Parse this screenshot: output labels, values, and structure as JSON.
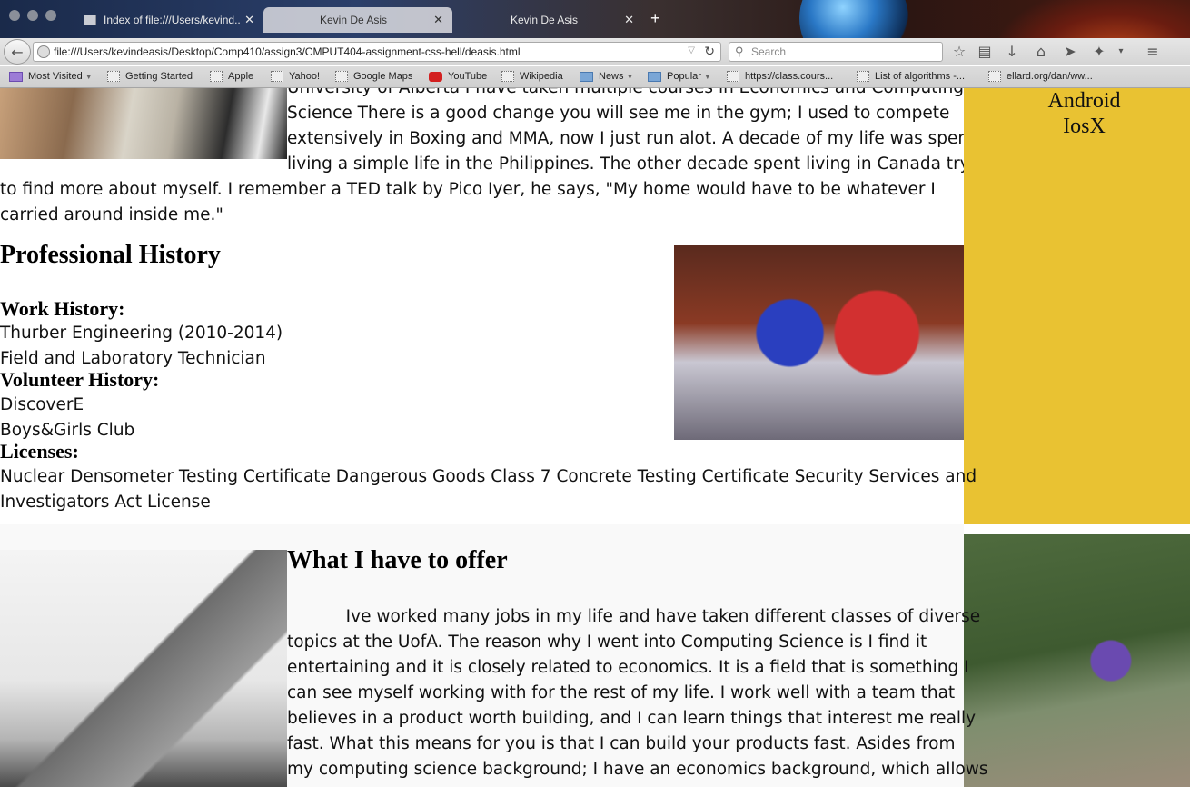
{
  "browser": {
    "tabs": [
      {
        "title": "Index of file:///Users/kevind...",
        "active": false
      },
      {
        "title": "Kevin De Asis",
        "active": true
      },
      {
        "title": "Kevin De Asis",
        "active": false
      }
    ],
    "new_tab": "+",
    "url": "file:///Users/kevindeasis/Desktop/Comp410/assign3/CMPUT404-assignment-css-hell/deasis.html",
    "search_placeholder": "Search",
    "bookmarks": [
      {
        "label": "Most Visited",
        "type": "folder",
        "has_arrow": true
      },
      {
        "label": "Getting Started",
        "type": "page"
      },
      {
        "label": "Apple",
        "type": "page"
      },
      {
        "label": "Yahoo!",
        "type": "page"
      },
      {
        "label": "Google Maps",
        "type": "page"
      },
      {
        "label": "YouTube",
        "type": "youtube"
      },
      {
        "label": "Wikipedia",
        "type": "page"
      },
      {
        "label": "News",
        "type": "folder",
        "has_arrow": true
      },
      {
        "label": "Popular",
        "type": "folder",
        "has_arrow": true
      },
      {
        "label": "https://class.cours...",
        "type": "page"
      },
      {
        "label": "List of algorithms -...",
        "type": "page"
      },
      {
        "label": "ellard.org/dan/ww...",
        "type": "page"
      }
    ]
  },
  "page": {
    "about": {
      "lines_right": [
        "University of Alberta I have taken multiple courses in Economics and Computing",
        "Science There is a good change you will see me in the gym; I used to compete",
        "extensively in Boxing and MMA, now I just run alot. A decade of my life was spent",
        "living a simple life in the Philippines. The other decade spent living in Canada trying"
      ],
      "lines_full": [
        "to find more about myself. I remember a TED talk by Pico Iyer, he says, \"My home would have to be whatever I",
        "carried around inside me.\""
      ]
    },
    "sidebar": {
      "items": [
        "Android",
        "IosX"
      ]
    },
    "professional": {
      "title": "Professional History",
      "work_heading": "Work History:",
      "work_items": [
        "Thurber Engineering (2010-2014)",
        "Field and Laboratory Technician"
      ],
      "volunteer_heading": "Volunteer History:",
      "volunteer_items": [
        "DiscoverE",
        "Boys&Girls Club"
      ],
      "licenses_heading": "Licenses:",
      "licenses_lines": [
        "Nuclear Densometer Testing Certificate Dangerous Goods Class 7 Concrete Testing Certificate Security Services and",
        "Investigators Act License"
      ]
    },
    "offer": {
      "title": "What I have to offer",
      "lines": [
        "           Ive worked many jobs in my life and have taken different classes of diverse",
        "topics at the UofA. The reason why I went into Computing Science is I find it",
        "entertaining and it is closely related to economics. It is a field that is something I",
        "can see myself working with for the rest of my life. I work well with a team that",
        "believes in a product worth building, and I can learn things that interest me really",
        "fast. What this means for you is that I can build your products fast. Asides from",
        "my computing science background; I have an economics background, which allows"
      ]
    }
  }
}
